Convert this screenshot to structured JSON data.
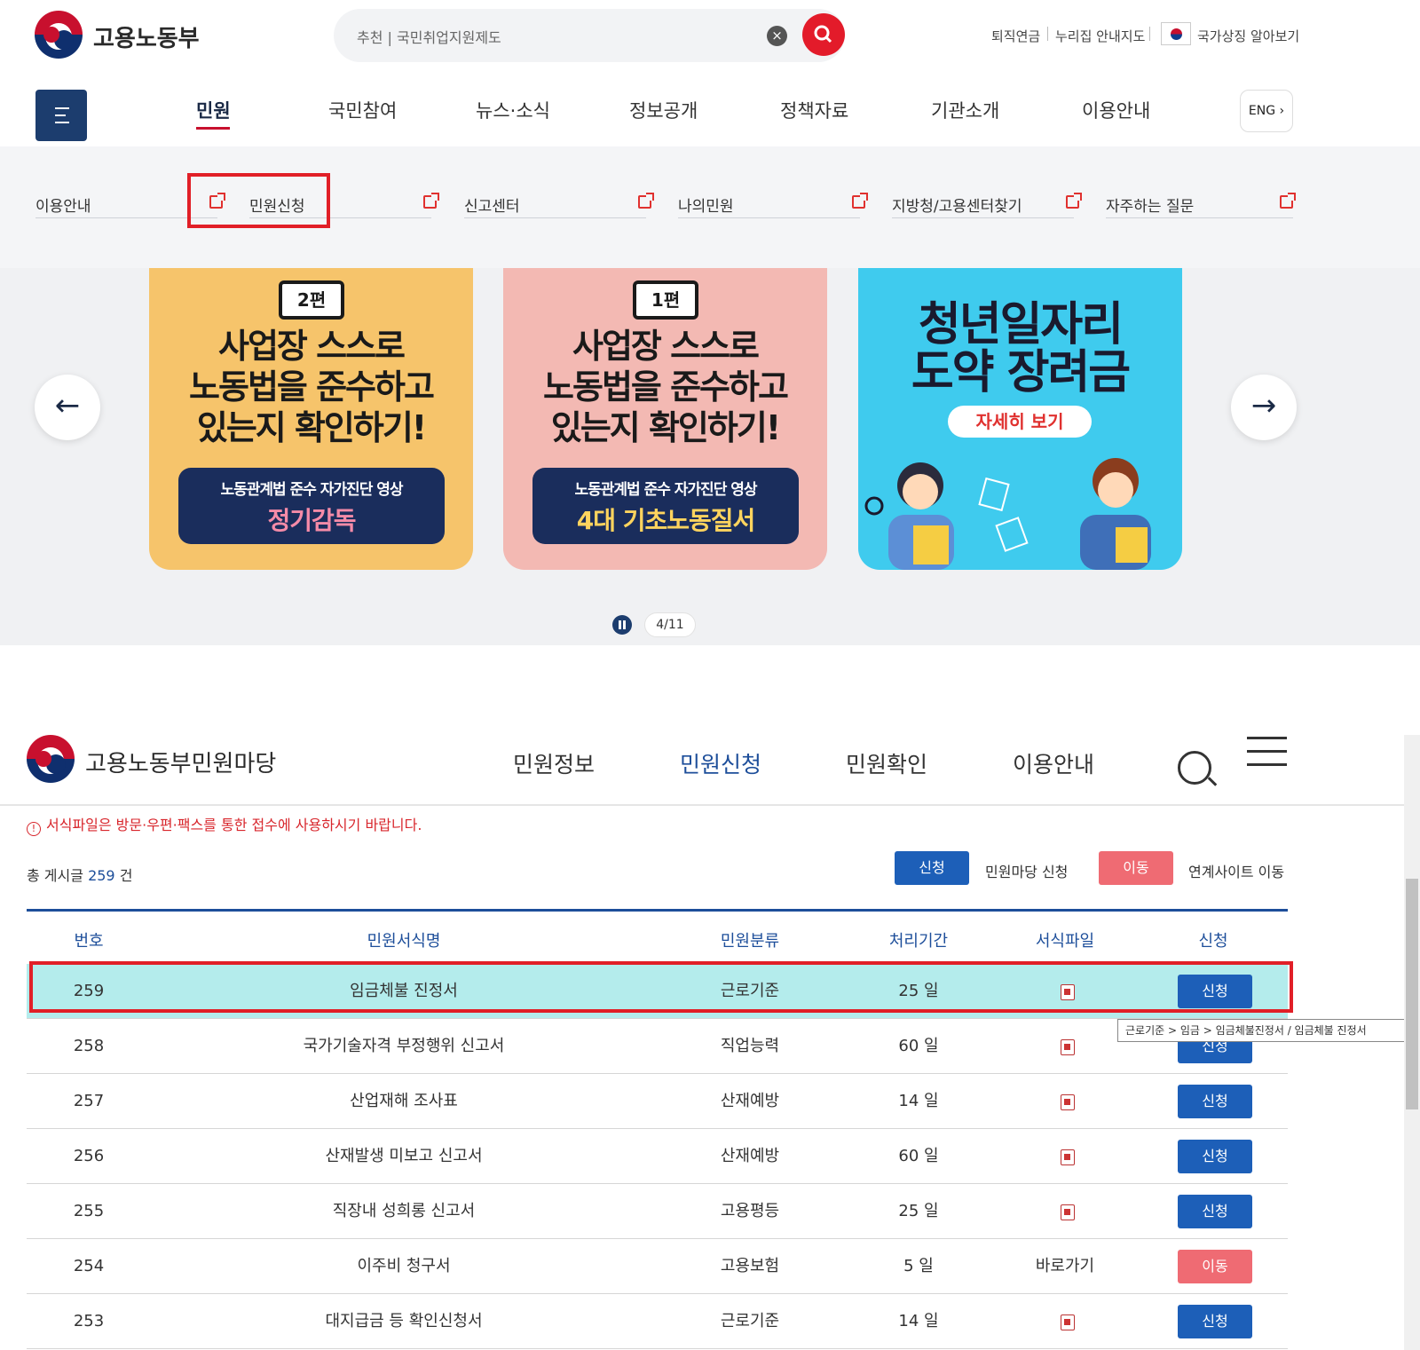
{
  "header": {
    "logo_text": "고용노동부",
    "search_placeholder": "추천 | 국민취업지원제도",
    "utils": [
      "퇴직연금",
      "누리집 안내지도",
      "국가상징 알아보기"
    ],
    "gnb": [
      "민원",
      "국민참여",
      "뉴스·소식",
      "정보공개",
      "정책자료",
      "기관소개",
      "이용안내"
    ],
    "active_gnb": "민원",
    "eng_label": "ENG ›"
  },
  "submenu": [
    "이용안내",
    "민원신청",
    "신고센터",
    "나의민원",
    "지방청/고용센터찾기",
    "자주하는 질문"
  ],
  "carousel": {
    "banners": [
      {
        "tag": "2편",
        "lines": [
          "사업장 스스로",
          "노동법을 준수하고",
          "있는지 확인하기!"
        ],
        "sub1": "노동관계법 준수 자가진단 영상",
        "sub2": "정기감독",
        "bg": "#f6c46b"
      },
      {
        "tag": "1편",
        "lines": [
          "사업장 스스로",
          "노동법을 준수하고",
          "있는지 확인하기!"
        ],
        "sub1": "노동관계법 준수 자가진단 영상",
        "sub2": "4대 기초노동질서",
        "bg": "#f3b9b3"
      },
      {
        "lines": [
          "청년일자리",
          "도약 장려금"
        ],
        "button": "자세히 보기",
        "bg": "#3fcbee"
      }
    ],
    "prev_icon": "←",
    "next_icon": "→",
    "counter": "4/11"
  },
  "minwon": {
    "logo_text": "고용노동부민원마당",
    "nav": [
      "민원정보",
      "민원신청",
      "민원확인",
      "이용안내"
    ],
    "active_nav": "민원신청",
    "notice": "서식파일은 방문·우편·팩스를 통한 접수에 사용하시기 바랍니다.",
    "total_prefix": "총 게시글",
    "total_count": "259",
    "total_suffix": "건",
    "legend": [
      {
        "btn": "신청",
        "text": "민원마당 신청",
        "color": "#1d5fb8"
      },
      {
        "btn": "이동",
        "text": "연계사이트 이동",
        "color": "#ef6b73"
      }
    ],
    "columns": [
      "번호",
      "민원서식명",
      "민원분류",
      "처리기간",
      "서식파일",
      "신청"
    ],
    "rows": [
      {
        "no": "259",
        "name": "임금체불 진정서",
        "category": "근로기준",
        "period": "25 일",
        "file": "file-icon",
        "action": "신청",
        "highlighted": true
      },
      {
        "no": "258",
        "name": "국가기술자격 부정행위 신고서",
        "category": "직업능력",
        "period": "60 일",
        "file": "file-icon",
        "action": "신청"
      },
      {
        "no": "257",
        "name": "산업재해 조사표",
        "category": "산재예방",
        "period": "14 일",
        "file": "file-icon",
        "action": "신청"
      },
      {
        "no": "256",
        "name": "산재발생 미보고 신고서",
        "category": "산재예방",
        "period": "60 일",
        "file": "file-icon",
        "action": "신청"
      },
      {
        "no": "255",
        "name": "직장내 성희롱 신고서",
        "category": "고용평등",
        "period": "25 일",
        "file": "file-icon",
        "action": "신청"
      },
      {
        "no": "254",
        "name": "이주비 청구서",
        "category": "고용보험",
        "period": "5 일",
        "file": "바로가기",
        "action": "이동"
      },
      {
        "no": "253",
        "name": "대지급금 등 확인신청서",
        "category": "근로기준",
        "period": "14 일",
        "file": "file-icon",
        "action": "신청"
      }
    ],
    "tooltip": "근로기준 > 임금 > 임금체불진정서 / 임금체불 진정서"
  },
  "colors": {
    "accent_blue": "#1d5fb8",
    "accent_red": "#ef6b73",
    "highlight": "#b4ecec",
    "annotation": "#e11f27"
  }
}
